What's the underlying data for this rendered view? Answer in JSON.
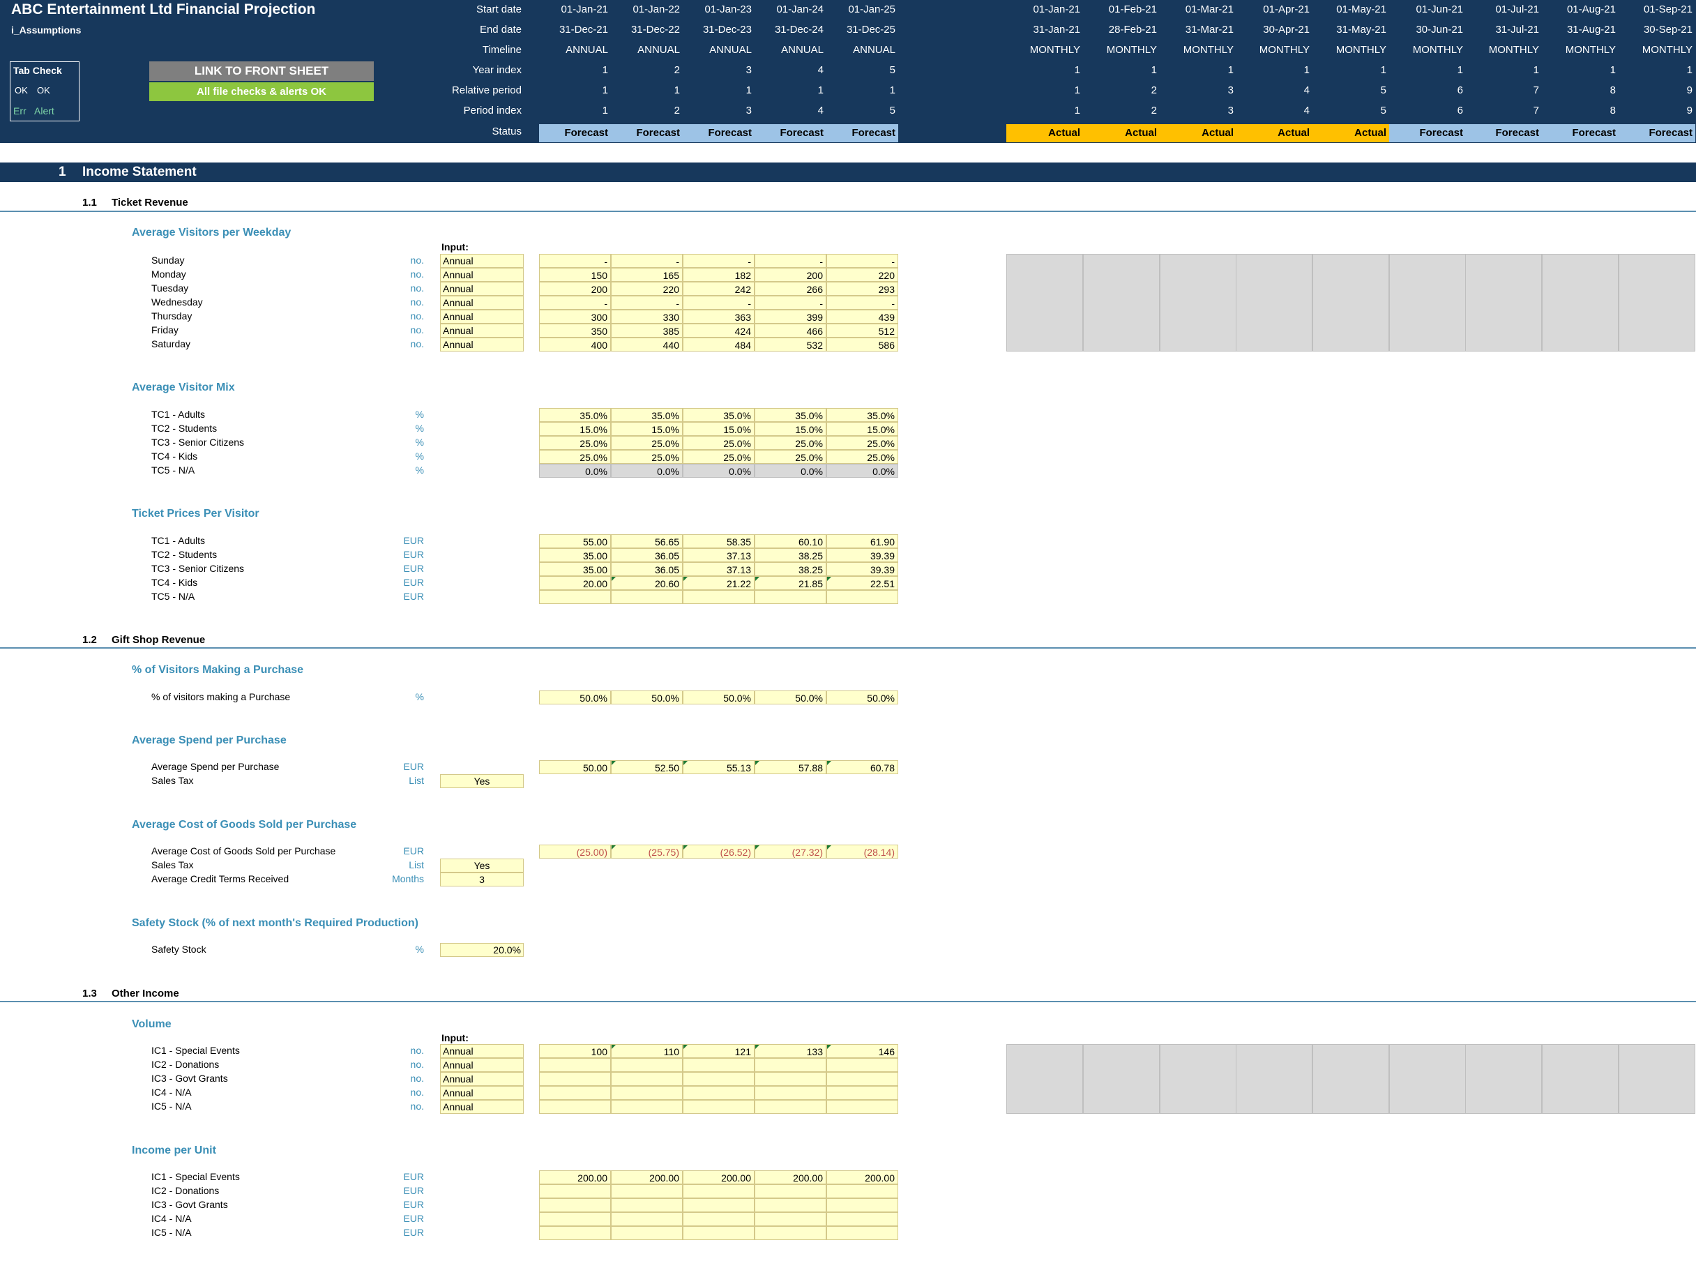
{
  "header": {
    "title": "ABC Entertainment Ltd Financial Projection",
    "sheet_name": "i_Assumptions",
    "row_labels": [
      "Start date",
      "End date",
      "Timeline",
      "Year index",
      "Relative period",
      "Period index",
      "Status"
    ],
    "annual": {
      "start": [
        "01-Jan-21",
        "01-Jan-22",
        "01-Jan-23",
        "01-Jan-24",
        "01-Jan-25"
      ],
      "end": [
        "31-Dec-21",
        "31-Dec-22",
        "31-Dec-23",
        "31-Dec-24",
        "31-Dec-25"
      ],
      "timeline": [
        "ANNUAL",
        "ANNUAL",
        "ANNUAL",
        "ANNUAL",
        "ANNUAL"
      ],
      "year_index": [
        "1",
        "2",
        "3",
        "4",
        "5"
      ],
      "relative": [
        "1",
        "1",
        "1",
        "1",
        "1"
      ],
      "period": [
        "1",
        "2",
        "3",
        "4",
        "5"
      ],
      "status": [
        "Forecast",
        "Forecast",
        "Forecast",
        "Forecast",
        "Forecast"
      ]
    },
    "monthly": {
      "start": [
        "01-Jan-21",
        "01-Feb-21",
        "01-Mar-21",
        "01-Apr-21",
        "01-May-21",
        "01-Jun-21",
        "01-Jul-21",
        "01-Aug-21",
        "01-Sep-21"
      ],
      "end": [
        "31-Jan-21",
        "28-Feb-21",
        "31-Mar-21",
        "30-Apr-21",
        "31-May-21",
        "30-Jun-21",
        "31-Jul-21",
        "31-Aug-21",
        "30-Sep-21"
      ],
      "timeline": [
        "MONTHLY",
        "MONTHLY",
        "MONTHLY",
        "MONTHLY",
        "MONTHLY",
        "MONTHLY",
        "MONTHLY",
        "MONTHLY",
        "MONTHLY"
      ],
      "year_index": [
        "1",
        "1",
        "1",
        "1",
        "1",
        "1",
        "1",
        "1",
        "1"
      ],
      "relative": [
        "1",
        "2",
        "3",
        "4",
        "5",
        "6",
        "7",
        "8",
        "9"
      ],
      "period": [
        "1",
        "2",
        "3",
        "4",
        "5",
        "6",
        "7",
        "8",
        "9"
      ],
      "status": [
        "Actual",
        "Actual",
        "Actual",
        "Actual",
        "Actual",
        "Forecast",
        "Forecast",
        "Forecast",
        "Forecast"
      ]
    },
    "tab_check": {
      "title": "Tab Check",
      "ok1": "OK",
      "ok2": "OK",
      "err": "Err",
      "alert": "Alert"
    },
    "link_button": "LINK TO FRONT SHEET",
    "checks_status": "All file checks & alerts OK",
    "colors": {
      "header_bg": "#17385c",
      "forecast": "#9dc3e6",
      "actual": "#ffc000",
      "input": "#ffffcc",
      "ok_green": "#8dc63f",
      "link_gray": "#7f7f7f"
    }
  },
  "section": {
    "num": "1",
    "title": "Income Statement"
  },
  "subsections": [
    {
      "num": "1.1",
      "title": "Ticket Revenue"
    },
    {
      "num": "1.2",
      "title": "Gift Shop Revenue"
    },
    {
      "num": "1.3",
      "title": "Other Income"
    }
  ],
  "input_header": "Input:",
  "visitors": {
    "title": "Average Visitors per Weekday",
    "rows": [
      {
        "label": "Sunday",
        "unit": "no.",
        "input": "Annual",
        "values": [
          "-",
          "-",
          "-",
          "-",
          "-"
        ]
      },
      {
        "label": "Monday",
        "unit": "no.",
        "input": "Annual",
        "values": [
          "150",
          "165",
          "182",
          "200",
          "220"
        ]
      },
      {
        "label": "Tuesday",
        "unit": "no.",
        "input": "Annual",
        "values": [
          "200",
          "220",
          "242",
          "266",
          "293"
        ]
      },
      {
        "label": "Wednesday",
        "unit": "no.",
        "input": "Annual",
        "values": [
          "-",
          "-",
          "-",
          "-",
          "-"
        ]
      },
      {
        "label": "Thursday",
        "unit": "no.",
        "input": "Annual",
        "values": [
          "300",
          "330",
          "363",
          "399",
          "439"
        ]
      },
      {
        "label": "Friday",
        "unit": "no.",
        "input": "Annual",
        "values": [
          "350",
          "385",
          "424",
          "466",
          "512"
        ]
      },
      {
        "label": "Saturday",
        "unit": "no.",
        "input": "Annual",
        "values": [
          "400",
          "440",
          "484",
          "532",
          "586"
        ]
      }
    ]
  },
  "mix": {
    "title": "Average Visitor Mix",
    "rows": [
      {
        "label": "TC1 - Adults",
        "unit": "%",
        "values": [
          "35.0%",
          "35.0%",
          "35.0%",
          "35.0%",
          "35.0%"
        ]
      },
      {
        "label": "TC2 - Students",
        "unit": "%",
        "values": [
          "15.0%",
          "15.0%",
          "15.0%",
          "15.0%",
          "15.0%"
        ]
      },
      {
        "label": "TC3 - Senior Citizens",
        "unit": "%",
        "values": [
          "25.0%",
          "25.0%",
          "25.0%",
          "25.0%",
          "25.0%"
        ]
      },
      {
        "label": "TC4 - Kids",
        "unit": "%",
        "values": [
          "25.0%",
          "25.0%",
          "25.0%",
          "25.0%",
          "25.0%"
        ]
      },
      {
        "label": "TC5 - N/A",
        "unit": "%",
        "values": [
          "0.0%",
          "0.0%",
          "0.0%",
          "0.0%",
          "0.0%"
        ]
      }
    ]
  },
  "prices": {
    "title": "Ticket Prices Per Visitor",
    "rows": [
      {
        "label": "TC1 - Adults",
        "unit": "EUR",
        "values": [
          "55.00",
          "56.65",
          "58.35",
          "60.10",
          "61.90"
        ]
      },
      {
        "label": "TC2 - Students",
        "unit": "EUR",
        "values": [
          "35.00",
          "36.05",
          "37.13",
          "38.25",
          "39.39"
        ]
      },
      {
        "label": "TC3 - Senior Citizens",
        "unit": "EUR",
        "values": [
          "35.00",
          "36.05",
          "37.13",
          "38.25",
          "39.39"
        ]
      },
      {
        "label": "TC4 - Kids",
        "unit": "EUR",
        "values": [
          "20.00",
          "20.60",
          "21.22",
          "21.85",
          "22.51"
        ]
      },
      {
        "label": "TC5 - N/A",
        "unit": "EUR",
        "values": [
          "",
          "",
          "",
          "",
          ""
        ]
      }
    ]
  },
  "pct_purchase": {
    "title": "% of Visitors Making a Purchase",
    "row": {
      "label": "% of visitors making a Purchase",
      "unit": "%",
      "values": [
        "50.0%",
        "50.0%",
        "50.0%",
        "50.0%",
        "50.0%"
      ]
    }
  },
  "avg_spend": {
    "title": "Average Spend per Purchase",
    "row": {
      "label": "Average Spend per Purchase",
      "unit": "EUR",
      "values": [
        "50.00",
        "52.50",
        "55.13",
        "57.88",
        "60.78"
      ]
    },
    "tax": {
      "label": "Sales Tax",
      "unit": "List",
      "value": "Yes"
    }
  },
  "avg_cogs": {
    "title": "Average Cost of Goods Sold per Purchase",
    "row": {
      "label": "Average Cost of Goods Sold per Purchase",
      "unit": "EUR",
      "values": [
        "(25.00)",
        "(25.75)",
        "(26.52)",
        "(27.32)",
        "(28.14)"
      ]
    },
    "tax": {
      "label": "Sales Tax",
      "unit": "List",
      "value": "Yes"
    },
    "credit": {
      "label": "Average Credit Terms Received",
      "unit": "Months",
      "value": "3"
    }
  },
  "safety": {
    "title": "Safety Stock (% of next month's Required Production)",
    "row": {
      "label": "Safety Stock",
      "unit": "%",
      "value": "20.0%"
    }
  },
  "volume": {
    "title": "Volume",
    "rows": [
      {
        "label": "IC1 - Special Events",
        "unit": "no.",
        "input": "Annual",
        "values": [
          "100",
          "110",
          "121",
          "133",
          "146"
        ]
      },
      {
        "label": "IC2 - Donations",
        "unit": "no.",
        "input": "Annual",
        "values": [
          "",
          "",
          "",
          "",
          ""
        ]
      },
      {
        "label": "IC3 - Govt Grants",
        "unit": "no.",
        "input": "Annual",
        "values": [
          "",
          "",
          "",
          "",
          ""
        ]
      },
      {
        "label": "IC4 - N/A",
        "unit": "no.",
        "input": "Annual",
        "values": [
          "",
          "",
          "",
          "",
          ""
        ]
      },
      {
        "label": "IC5 - N/A",
        "unit": "no.",
        "input": "Annual",
        "values": [
          "",
          "",
          "",
          "",
          ""
        ]
      }
    ]
  },
  "income_unit": {
    "title": "Income per Unit",
    "rows": [
      {
        "label": "IC1 - Special Events",
        "unit": "EUR",
        "values": [
          "200.00",
          "200.00",
          "200.00",
          "200.00",
          "200.00"
        ]
      },
      {
        "label": "IC2 - Donations",
        "unit": "EUR",
        "values": [
          "",
          "",
          "",
          "",
          ""
        ]
      },
      {
        "label": "IC3 - Govt Grants",
        "unit": "EUR",
        "values": [
          "",
          "",
          "",
          "",
          ""
        ]
      },
      {
        "label": "IC4 - N/A",
        "unit": "EUR",
        "values": [
          "",
          "",
          "",
          "",
          ""
        ]
      },
      {
        "label": "IC5 - N/A",
        "unit": "EUR",
        "values": [
          "",
          "",
          "",
          "",
          ""
        ]
      }
    ]
  }
}
